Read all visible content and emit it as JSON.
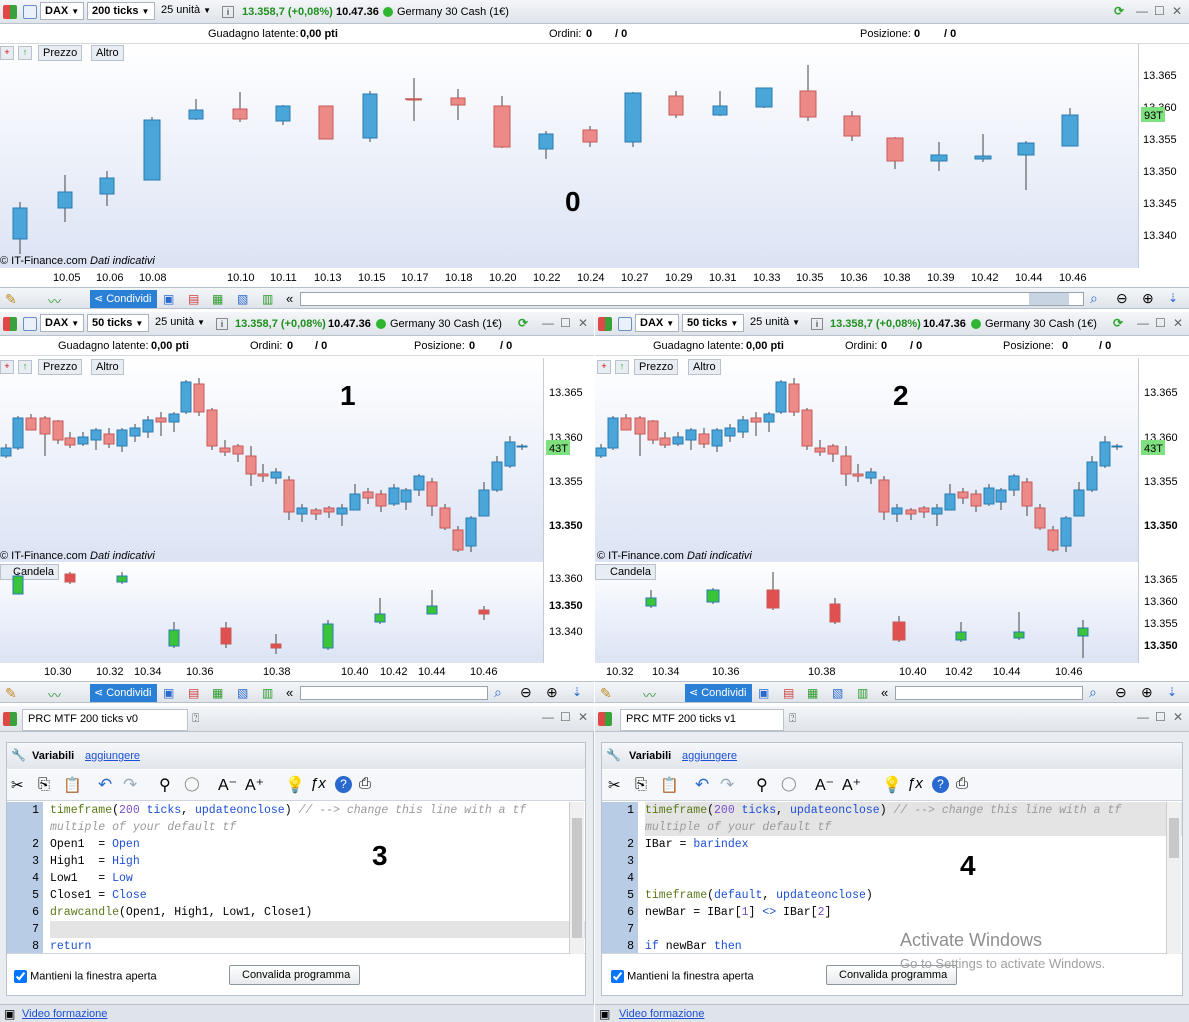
{
  "top": {
    "symbol": "DAX",
    "tf": "200 ticks",
    "qty": "25 unità",
    "price": "13.358,7 (+0,08%)",
    "time": "10.47.36",
    "instrument": "Germany 30 Cash (1€)",
    "gain_label": "Guadagno latente:",
    "gain_val": "0,00 pti",
    "orders_label": "Ordini:",
    "orders_a": "0",
    "orders_b": "/ 0",
    "pos_label": "Posizione:",
    "pos_a": "0",
    "pos_b": "/ 0",
    "tab_price": "Prezzo",
    "tab_other": "Altro",
    "copyright": "© IT-Finance.com",
    "indicative": "Dati indicativi",
    "badge": "93T",
    "y_ticks": [
      "13.365",
      "13.360",
      "13.355",
      "13.350",
      "13.345",
      "13.340"
    ],
    "x_ticks": [
      "10.05",
      "10.06",
      "10.08",
      "10.10",
      "10.11",
      "10.13",
      "10.15",
      "10.17",
      "10.18",
      "10.20",
      "10.22",
      "10.24",
      "10.27",
      "10.29",
      "10.31",
      "10.33",
      "10.35",
      "10.36",
      "10.38",
      "10.39",
      "10.42",
      "10.44",
      "10.46"
    ],
    "label": "0",
    "share": "Condividi"
  },
  "left": {
    "symbol": "DAX",
    "tf": "50 ticks",
    "qty": "25 unità",
    "price": "13.358,7 (+0,08%)",
    "time": "10.47.36",
    "instrument": "Germany 30 Cash (1€)",
    "gain_label": "Guadagno latente:",
    "gain_val": "0,00 pti",
    "orders_label": "Ordini:",
    "orders_a": "0",
    "orders_b": "/ 0",
    "pos_label": "Posizione:",
    "pos_a": "0",
    "pos_b": "/ 0",
    "tab_price": "Prezzo",
    "tab_other": "Altro",
    "copyright": "© IT-Finance.com",
    "indicative": "Dati indicativi",
    "badge": "43T",
    "y_ticks": [
      "13.365",
      "13.360",
      "13.355",
      "13.350"
    ],
    "sub_label": "Candela",
    "sub_y": [
      "13.360",
      "13.350",
      "13.340"
    ],
    "x_ticks": [
      "10.30",
      "10.32",
      "10.34",
      "10.36",
      "10.38",
      "10.40",
      "10.42",
      "10.44",
      "10.46"
    ],
    "label": "1",
    "share": "Condividi"
  },
  "right": {
    "symbol": "DAX",
    "tf": "50 ticks",
    "qty": "25 unità",
    "price": "13.358,7 (+0,08%)",
    "time": "10.47.36",
    "instrument": "Germany 30 Cash (1€)",
    "gain_label": "Guadagno latente:",
    "gain_val": "0,00 pti",
    "orders_label": "Ordini:",
    "orders_a": "0",
    "orders_b": "/ 0",
    "pos_label": "Posizione:",
    "pos_a": "0",
    "pos_b": "/ 0",
    "tab_price": "Prezzo",
    "tab_other": "Altro",
    "copyright": "© IT-Finance.com",
    "indicative": "Dati indicativi",
    "badge": "43T",
    "y_ticks": [
      "13.365",
      "13.360",
      "13.355",
      "13.350"
    ],
    "sub_label": "Candela",
    "sub_y": [
      "13.365",
      "13.360",
      "13.355",
      "13.350"
    ],
    "x_ticks": [
      "10.32",
      "10.34",
      "10.36",
      "10.38",
      "10.40",
      "10.42",
      "10.44",
      "10.46"
    ],
    "label": "2",
    "share": "Condividi"
  },
  "ed_left": {
    "tab": "PRC MTF 200 ticks v0",
    "vars": "Variabili",
    "add": "aggiungere",
    "label": "3",
    "keep": "Mantieni la finestra aperta",
    "validate": "Convalida programma",
    "video": "Video formazione",
    "lines": [
      {
        "n": "1",
        "html": "<span class=\"fn\">timeframe</span>(<span class=\"nm\">200</span> <span class=\"kw\">ticks</span>, <span class=\"kw\">updateonclose</span>) <span class=\"cm\">// --> change this line with a tf</span>"
      },
      {
        "n": "",
        "html": "<span class=\"cm\">multiple of your default tf</span>"
      },
      {
        "n": "2",
        "html": "Open1  = <span class=\"kw\">Open</span>"
      },
      {
        "n": "3",
        "html": "High1  = <span class=\"kw\">High</span>"
      },
      {
        "n": "4",
        "html": "Low1   = <span class=\"kw\">Low</span>"
      },
      {
        "n": "5",
        "html": "Close1 = <span class=\"kw\">Close</span>"
      },
      {
        "n": "6",
        "html": "<span class=\"fn\">drawcandle</span>(Open1, High1, Low1, Close1)"
      },
      {
        "n": "7",
        "html": ""
      },
      {
        "n": "8",
        "html": "<span class=\"kw\">return</span>"
      }
    ]
  },
  "ed_right": {
    "tab": "PRC MTF 200 ticks v1",
    "vars": "Variabili",
    "add": "aggiungere",
    "label": "4",
    "keep": "Mantieni la finestra aperta",
    "validate": "Convalida programma",
    "video": "Video formazione",
    "watermark1": "Activate Windows",
    "watermark2": "Go to Settings to activate Windows.",
    "lines": [
      {
        "n": "1",
        "html": "<span class=\"fn\">timeframe</span>(<span class=\"nm\">200</span> <span class=\"kw\">ticks</span>, <span class=\"kw\">updateonclose</span>) <span class=\"cm\">// --> change this line with a tf</span>"
      },
      {
        "n": "",
        "html": "<span class=\"cm\">multiple of your default tf</span>"
      },
      {
        "n": "2",
        "html": "IBar = <span class=\"kw\">barindex</span>"
      },
      {
        "n": "3",
        "html": ""
      },
      {
        "n": "4",
        "html": ""
      },
      {
        "n": "5",
        "html": "<span class=\"fn\">timeframe</span>(<span class=\"kw\">default</span>, <span class=\"kw\">updateonclose</span>)"
      },
      {
        "n": "6",
        "html": "newBar = IBar[<span class=\"nm\">1</span>] <span class=\"kw\">&lt;&gt;</span> IBar[<span class=\"nm\">2</span>]"
      },
      {
        "n": "7",
        "html": ""
      },
      {
        "n": "8",
        "html": "<span class=\"kw\">if</span> newBar <span class=\"kw\">then</span>"
      }
    ]
  },
  "colors": {
    "up": "#4aa6d8",
    "down": "#ec8a88",
    "gup": "#3ac43a",
    "gdown": "#e05050"
  }
}
